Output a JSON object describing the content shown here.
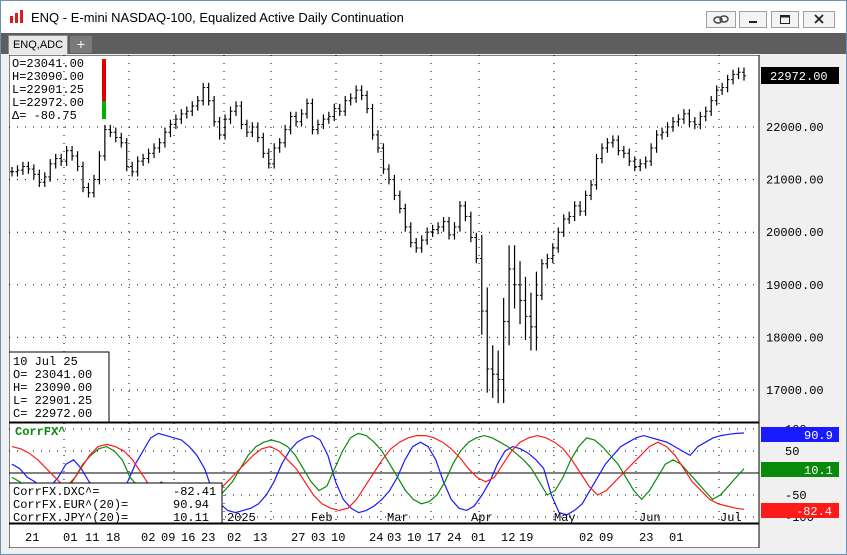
{
  "window": {
    "title": "ENQ - E-mini NASDAQ-100, Equalized Active Daily Continuation"
  },
  "tabs": [
    {
      "label": "ENQ,ADC"
    },
    {
      "label": "+"
    }
  ],
  "colors": {
    "price_bars": "#000000",
    "dxc_line": "#1a1aff",
    "eur_line": "#0a8a0a",
    "jpy_line": "#ff1a1a",
    "last_price_box": "#000000"
  },
  "ohlc_header": {
    "open": "O=23041.00",
    "high": "H=23090.00",
    "low": "L=22901.25",
    "low_last": "L=22972.00",
    "delta": "Δ=   -80.75"
  },
  "price_axis": {
    "ticks": [
      "22000.00",
      "21000.00",
      "20000.00",
      "19000.00",
      "18000.00",
      "17000.00"
    ],
    "last_price": "22972.00"
  },
  "data_box": {
    "date": "10 Jul 25",
    "open": "O=  23041.00",
    "high": "H=  23090.00",
    "low": "L=  22901.25",
    "close": "C=  22972.00"
  },
  "indicator": {
    "name": "CorrFX^",
    "axis_ticks": [
      "100",
      "50",
      "0",
      "-50",
      "-100"
    ],
    "values_box": [
      {
        "label": "CorrFX.DXC^=",
        "value": "-82.41"
      },
      {
        "label": "CorrFX.EUR^(20)=",
        "value": "90.94"
      },
      {
        "label": "CorrFX.JPY^(20)=",
        "value": "10.11"
      }
    ],
    "badges": [
      {
        "value": "90.9",
        "color": "#1a1aff"
      },
      {
        "value": "10.1",
        "color": "#0a8a0a"
      },
      {
        "value": "-82.4",
        "color": "#ff1a1a"
      }
    ]
  },
  "time_axis": {
    "months": [
      "2025",
      "Feb",
      "Mar",
      "Apr",
      "May",
      "Jun",
      "Jul"
    ],
    "days": [
      "21",
      "01",
      "11",
      "18",
      "02",
      "09",
      "16",
      "23",
      "02",
      "13",
      "27",
      "03",
      "10",
      "24",
      "03",
      "10",
      "17",
      "24",
      "01",
      "12",
      "19",
      "02",
      "09",
      "23",
      "01"
    ]
  },
  "chart_data": {
    "type": "bar",
    "title": "ENQ - E-mini NASDAQ-100, Equalized Active Daily Continuation",
    "ylim": [
      16500,
      23500
    ],
    "last": {
      "date": "10 Jul 25",
      "open": 23041.0,
      "high": 23090.0,
      "low": 22901.25,
      "close": 22972.0
    },
    "closes": [
      21150,
      21180,
      21250,
      21200,
      21100,
      20950,
      21050,
      21300,
      21400,
      21350,
      21550,
      21450,
      21250,
      20850,
      20750,
      21000,
      21450,
      21950,
      21900,
      21800,
      21700,
      21250,
      21150,
      21350,
      21400,
      21500,
      21600,
      21700,
      21900,
      22050,
      22150,
      22250,
      22300,
      22400,
      22500,
      22750,
      22500,
      22100,
      21850,
      22150,
      22300,
      22400,
      22050,
      21900,
      22000,
      21800,
      21500,
      21300,
      21600,
      21700,
      21950,
      22200,
      22100,
      22250,
      22450,
      21950,
      22050,
      22150,
      22200,
      22350,
      22300,
      22500,
      22550,
      22700,
      22600,
      22350,
      21850,
      21600,
      21200,
      21000,
      20700,
      20450,
      20100,
      19800,
      19700,
      19850,
      20000,
      20050,
      20100,
      20200,
      19950,
      20100,
      20500,
      20300,
      19900,
      19500,
      18500,
      17400,
      17300,
      17200,
      18300,
      19300,
      19000,
      18700,
      18400,
      18200,
      18800,
      19400,
      19500,
      19700,
      20000,
      20250,
      20300,
      20500,
      20400,
      20700,
      20900,
      21400,
      21600,
      21700,
      21750,
      21550,
      21500,
      21350,
      21250,
      21300,
      21350,
      21600,
      21850,
      21900,
      22000,
      22100,
      22150,
      22250,
      22100,
      22050,
      22200,
      22300,
      22500,
      22700,
      22750,
      22900,
      23000,
      23041,
      22972
    ],
    "series": [
      {
        "name": "CorrFX.DXC^",
        "last": -82.41,
        "values": [
          20,
          10,
          -10,
          -20,
          -40,
          -30,
          -10,
          20,
          30,
          10,
          -20,
          -40,
          -50,
          -60,
          -50,
          -20,
          20,
          50,
          80,
          90,
          85,
          80,
          75,
          60,
          40,
          10,
          -40,
          -70,
          -85,
          -90,
          -85,
          -80,
          -70,
          -50,
          -20,
          20,
          50,
          70,
          80,
          85,
          75,
          40,
          -20,
          -60,
          -80,
          -90,
          -85,
          -75,
          -60,
          -40,
          -10,
          30,
          60,
          70,
          60,
          30,
          -20,
          -60,
          -80,
          -85,
          -75,
          -50,
          -20,
          20,
          50,
          60,
          55,
          45,
          30,
          10,
          -50,
          -90,
          -95,
          -85,
          -70,
          -40,
          -10,
          20,
          40,
          60,
          70,
          80,
          85,
          80,
          75,
          70,
          60,
          50,
          40,
          60,
          70,
          80,
          85,
          88,
          90,
          90.9
        ]
      },
      {
        "name": "CorrFX.EUR^(20)",
        "last": 90.94,
        "values": [
          -10,
          -20,
          -40,
          -50,
          -60,
          -55,
          -45,
          -30,
          -10,
          20,
          40,
          55,
          60,
          50,
          30,
          -10,
          -30,
          -40,
          -35,
          -20,
          -40,
          -60,
          -70,
          -75,
          -80,
          -75,
          -60,
          -40,
          -20,
          10,
          40,
          60,
          70,
          75,
          70,
          60,
          40,
          10,
          -20,
          -40,
          -30,
          10,
          50,
          80,
          90,
          85,
          70,
          50,
          20,
          -10,
          -40,
          -60,
          -70,
          -65,
          -50,
          -20,
          20,
          50,
          70,
          80,
          85,
          80,
          70,
          60,
          45,
          30,
          10,
          -20,
          -50,
          -40,
          -10,
          30,
          60,
          80,
          75,
          60,
          40,
          20,
          -10,
          -40,
          -60,
          -40,
          -10,
          20,
          30,
          20,
          0,
          -20,
          -40,
          -60,
          -50,
          -30,
          -10,
          10.1
        ]
      },
      {
        "name": "CorrFX.JPY^(20)",
        "last": 10.11,
        "values": [
          60,
          55,
          45,
          30,
          10,
          -10,
          -30,
          -20,
          10,
          40,
          60,
          65,
          60,
          50,
          30,
          0,
          -30,
          -60,
          -75,
          -80,
          -85,
          -80,
          -70,
          -60,
          -40,
          -20,
          0,
          20,
          40,
          55,
          60,
          50,
          30,
          10,
          -20,
          -50,
          -70,
          -80,
          -85,
          -80,
          -60,
          -30,
          0,
          30,
          55,
          70,
          80,
          85,
          85,
          80,
          70,
          55,
          35,
          10,
          -10,
          -20,
          -10,
          20,
          50,
          70,
          80,
          85,
          80,
          70,
          55,
          30,
          0,
          -30,
          -50,
          -40,
          -20,
          0,
          20,
          40,
          60,
          70,
          60,
          40,
          10,
          -20,
          -40,
          -60,
          -70,
          -75,
          -80,
          -82.4
        ]
      }
    ]
  }
}
